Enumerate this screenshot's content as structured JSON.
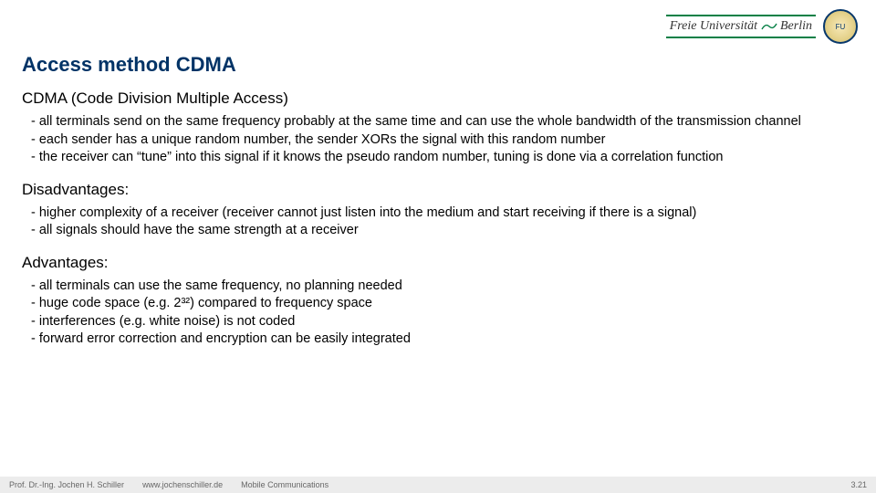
{
  "logo": {
    "text": "Freie Universität",
    "suffix": "Berlin",
    "seal_label": "FU"
  },
  "title": "Access method CDMA",
  "sections": [
    {
      "heading": "CDMA (Code Division Multiple Access)",
      "items": [
        "all terminals send on the same frequency probably at the same time and can use the whole bandwidth of the transmission channel",
        "each sender has a unique random number, the sender XORs the signal with this random number",
        "the receiver can “tune” into this signal if it knows the pseudo random number, tuning is done via a correlation function"
      ]
    },
    {
      "heading": "Disadvantages:",
      "items": [
        "higher complexity of a receiver (receiver cannot just listen into the medium and start receiving if there is a signal)",
        "all signals should have the same strength at a receiver"
      ]
    },
    {
      "heading": "Advantages:",
      "items": [
        "all terminals can use the same frequency, no planning needed",
        "huge code space (e.g. 2³²) compared to frequency space",
        "interferences (e.g. white noise) is not coded",
        "forward error correction and encryption can be easily integrated"
      ]
    }
  ],
  "footer": {
    "author": "Prof. Dr.-Ing. Jochen H. Schiller",
    "url": "www.jochenschiller.de",
    "course": "Mobile Communications",
    "page": "3.21"
  }
}
